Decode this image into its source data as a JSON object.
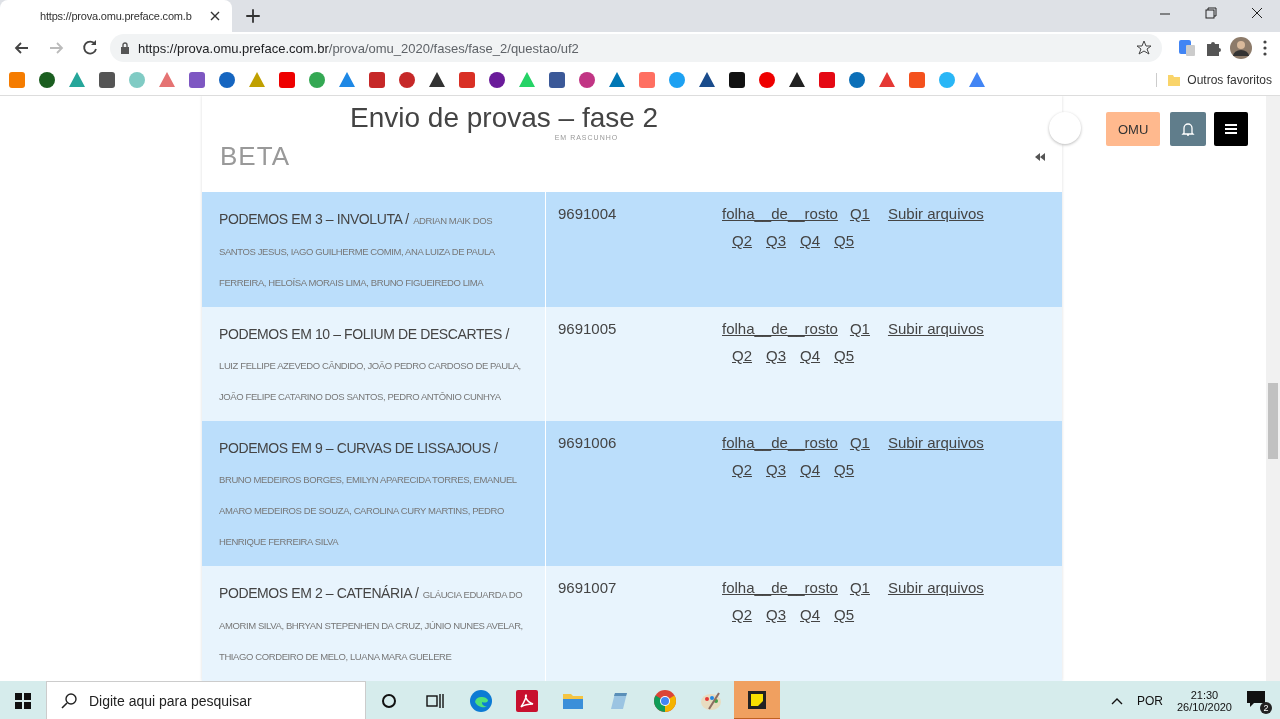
{
  "browser": {
    "tab_title": "https://prova.omu.preface.com.b",
    "url_host": "https://prova.omu.preface.com.br",
    "url_path": "/prova/omu_2020/fases/fase_2/questao/uf2",
    "other_bookmarks": "Outros favoritos"
  },
  "page": {
    "title": "Envio de provas – fase 2",
    "status": "EM RASCUNHO",
    "section": "BETA",
    "user_button": "OMU"
  },
  "rows": [
    {
      "team": "PODEMOS EM 3 – INVOLUTA /",
      "members": "ADRIAN MAIK DOS SANTOS JESUS, IAGO GUILHERME COMIM, ANA LUIZA DE PAULA FERREIRA, HELOÍSA MORAIS LIMA, BRUNO FIGUEIREDO LIMA",
      "code": "9691004",
      "links": [
        "folha__de__rosto",
        "Q1",
        "Subir arquivos",
        "Q2",
        "Q3",
        "Q4",
        "Q5"
      ],
      "highlighted": true
    },
    {
      "team": "PODEMOS EM 10 – FOLIUM DE DESCARTES /",
      "members": "LUIZ FELLIPE AZEVEDO CÂNDIDO, JOÃO PEDRO CARDOSO DE PAULA, JOÃO FELIPE CATARINO DOS SANTOS, PEDRO ANTÔNIO CUNHYA",
      "code": "9691005",
      "links": [
        "folha__de__rosto",
        "Q1",
        "Subir arquivos",
        "Q2",
        "Q3",
        "Q4",
        "Q5"
      ],
      "highlighted": false
    },
    {
      "team": "PODEMOS EM 9 – CURVAS DE LISSAJOUS /",
      "members": "BRUNO MEDEIROS BORGES, EMILYN APARECIDA TORRES, EMANUEL AMARO MEDEIROS DE SOUZA, CAROLINA CURY MARTINS, PEDRO HENRIQUE FERREIRA SILVA",
      "code": "9691006",
      "links": [
        "folha__de__rosto",
        "Q1",
        "Subir arquivos",
        "Q2",
        "Q3",
        "Q4",
        "Q5"
      ],
      "highlighted": true
    },
    {
      "team": "PODEMOS EM 2 – CATENÁRIA /",
      "members": "GLÁUCIA EDUARDA DO AMORIM SILVA, BHRYAN STEPENHEN DA CRUZ, JÚNIO NUNES AVELAR, THIAGO CORDEIRO DE MELO, LUANA MARA GUELERE",
      "code": "9691007",
      "links": [
        "folha__de__rosto",
        "Q1",
        "Subir arquivos",
        "Q2",
        "Q3",
        "Q4",
        "Q5"
      ],
      "highlighted": false
    }
  ],
  "taskbar": {
    "search_placeholder": "Digite aqui para pesquisar",
    "apps": [
      {
        "kind": "edge",
        "selected": false
      },
      {
        "kind": "pdf",
        "selected": false
      },
      {
        "kind": "folder",
        "selected": false
      },
      {
        "kind": "notepad",
        "selected": false
      },
      {
        "kind": "chrome",
        "selected": false
      },
      {
        "kind": "paint",
        "selected": false
      },
      {
        "kind": "sticky",
        "selected": true
      }
    ],
    "language": "POR",
    "time": "21:30",
    "date": "26/10/2020",
    "notifications": "2"
  }
}
